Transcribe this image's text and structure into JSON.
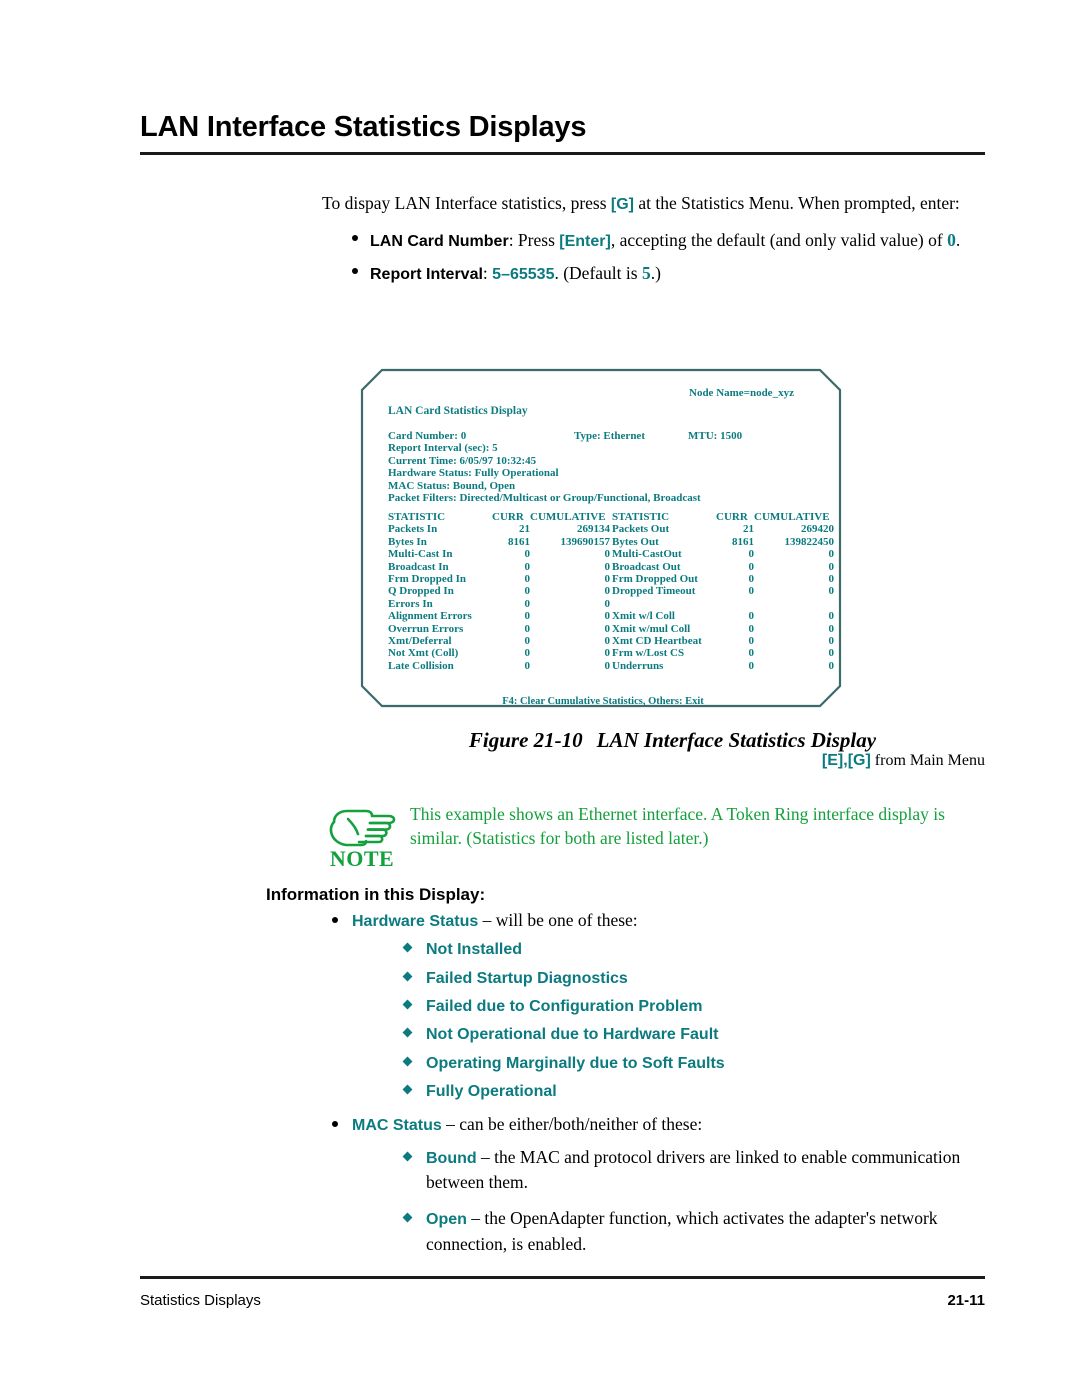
{
  "colors": {
    "teal": "#0b7b80",
    "green": "#14a03c",
    "black": "#000000",
    "box_border": "#3d6b6b"
  },
  "header": {
    "title": "LAN Interface Statistics Displays"
  },
  "intro": {
    "line1_a": "To dispay LAN Interface statistics, press ",
    "line1_key": "[G]",
    "line1_b": " at the Statistics Menu. When prompted, enter:",
    "bullets": [
      {
        "label": "LAN Card Number",
        "text_a": ": Press ",
        "key": "[Enter]",
        "text_b": ", accepting the default (and only valid value) of ",
        "value": "0",
        "text_c": "."
      },
      {
        "label": "Report Interval",
        "text_a": ": ",
        "value": "5–65535",
        "text_b": ". (Default is ",
        "value2": "5",
        "text_c": ".)"
      }
    ]
  },
  "terminal": {
    "node_name": "Node Name=node_xyz",
    "screen_title": "LAN Card Statistics Display",
    "info_rows": [
      {
        "name": "Card Number: 0",
        "type": "Type:  Ethernet",
        "mtu": "MTU:  1500"
      },
      {
        "name": "Report Interval (sec): 5",
        "type": "",
        "mtu": ""
      },
      {
        "name": "Current Time: 6/05/97   10:32:45",
        "type": "",
        "mtu": ""
      },
      {
        "name": "Hardware Status:  Fully Operational",
        "type": "",
        "mtu": ""
      },
      {
        "name": "MAC Status:  Bound, Open",
        "type": "",
        "mtu": ""
      },
      {
        "name": "Packet Filters:  Directed/Multicast or Group/Functional, Broadcast",
        "type": "",
        "mtu": ""
      }
    ],
    "columns": [
      "STATISTIC",
      "CURR",
      "CUMULATIVE"
    ],
    "left_rows": [
      {
        "stat": "Packets In",
        "curr": "21",
        "cum": "269134"
      },
      {
        "stat": "Bytes In",
        "curr": "8161",
        "cum": "139690157"
      },
      {
        "stat": "Multi-Cast In",
        "curr": "0",
        "cum": "0"
      },
      {
        "stat": "Broadcast In",
        "curr": "0",
        "cum": "0"
      },
      {
        "stat": "Frm Dropped In",
        "curr": "0",
        "cum": "0"
      },
      {
        "stat": "Q Dropped In",
        "curr": "0",
        "cum": "0"
      },
      {
        "stat": "Errors In",
        "curr": "0",
        "cum": "0"
      },
      {
        "stat": "Alignment Errors",
        "curr": "0",
        "cum": "0"
      },
      {
        "stat": "Overrun Errors",
        "curr": "0",
        "cum": "0"
      },
      {
        "stat": "Xmt/Deferral",
        "curr": "0",
        "cum": "0"
      },
      {
        "stat": "Not Xmt (Coll)",
        "curr": "0",
        "cum": "0"
      },
      {
        "stat": "Late Collision",
        "curr": "0",
        "cum": "0"
      }
    ],
    "right_rows": [
      {
        "stat": "Packets Out",
        "curr": "21",
        "cum": "269420"
      },
      {
        "stat": "Bytes Out",
        "curr": "8161",
        "cum": "139822450"
      },
      {
        "stat": "Multi-CastOut",
        "curr": "0",
        "cum": "0"
      },
      {
        "stat": "Broadcast Out",
        "curr": "0",
        "cum": "0"
      },
      {
        "stat": "Frm Dropped Out",
        "curr": "0",
        "cum": "0"
      },
      {
        "stat": "Dropped Timeout",
        "curr": "0",
        "cum": "0"
      },
      {
        "stat": "",
        "curr": "",
        "cum": ""
      },
      {
        "stat": "Xmit w/l Coll",
        "curr": "0",
        "cum": "0"
      },
      {
        "stat": "Xmit w/mul Coll",
        "curr": "0",
        "cum": "0"
      },
      {
        "stat": "Xmt CD Heartbeat",
        "curr": "0",
        "cum": "0"
      },
      {
        "stat": "Frm w/Lost CS",
        "curr": "0",
        "cum": "0"
      },
      {
        "stat": "Underruns",
        "curr": "0",
        "cum": "0"
      }
    ],
    "footer": "F4: Clear  Cumulative Statistics, Others: Exit"
  },
  "figure": {
    "number": "Figure 21-10",
    "caption": "LAN Interface Statistics Display",
    "path_keys": "[E],[G]",
    "path_text": " from Main Menu"
  },
  "note": {
    "word": "NOTE",
    "icon": "pointing-hand-icon",
    "text": "This example shows an Ethernet interface. A Token Ring interface display is similar. (Statistics for both are listed later.)"
  },
  "information": {
    "heading": "Information in this Display:",
    "items": [
      {
        "label": "Hardware Status",
        "rest": " – will be one of these:",
        "sub": [
          {
            "strong": "Not Installed",
            "rest": ""
          },
          {
            "strong": "Failed Startup Diagnostics",
            "rest": ""
          },
          {
            "strong": "Failed due to Configuration Problem",
            "rest": ""
          },
          {
            "strong": "Not Operational due to Hardware Fault",
            "rest": ""
          },
          {
            "strong": "Operating Marginally due to Soft Faults",
            "rest": ""
          },
          {
            "strong": "Fully Operational",
            "rest": ""
          }
        ]
      },
      {
        "label": "MAC Status",
        "rest": " – can be either/both/neither of these:",
        "sub": [
          {
            "strong": "Bound",
            "rest": " – the MAC and protocol drivers are linked to enable communication between them."
          },
          {
            "strong": "Open",
            "rest": " – the OpenAdapter function, which activates the adapter's network connection, is enabled."
          }
        ]
      }
    ]
  },
  "footer": {
    "left": "Statistics Displays",
    "right": "21-11"
  }
}
